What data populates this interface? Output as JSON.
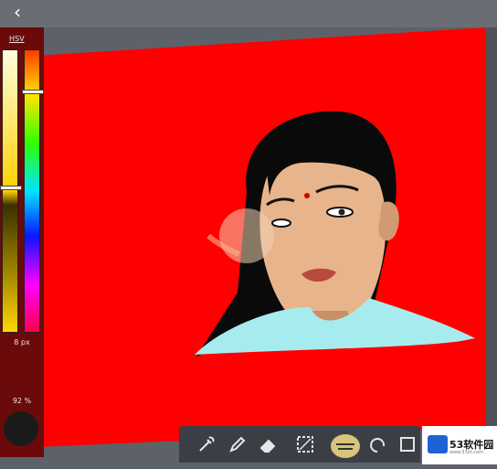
{
  "app": {
    "back_icon": "chevron-left-icon"
  },
  "color_panel": {
    "mode_label": "HSV",
    "brush_size": "8 px",
    "opacity": "92 %",
    "value_level": 0.48,
    "hue_level": 0.14,
    "current_color": "#1a1a1a"
  },
  "canvas": {
    "background_color": "#ff0000"
  },
  "toolbar": {
    "tools": [
      {
        "icon": "eyedropper-icon"
      },
      {
        "icon": "pencil-icon"
      },
      {
        "icon": "eraser-icon"
      },
      {
        "icon": "selection-icon"
      },
      {
        "icon": "smudge-icon"
      },
      {
        "icon": "undo-icon"
      },
      {
        "icon": "layers-icon"
      }
    ]
  },
  "watermark": {
    "brand": "53软件园",
    "url": "www.53xt.com"
  }
}
